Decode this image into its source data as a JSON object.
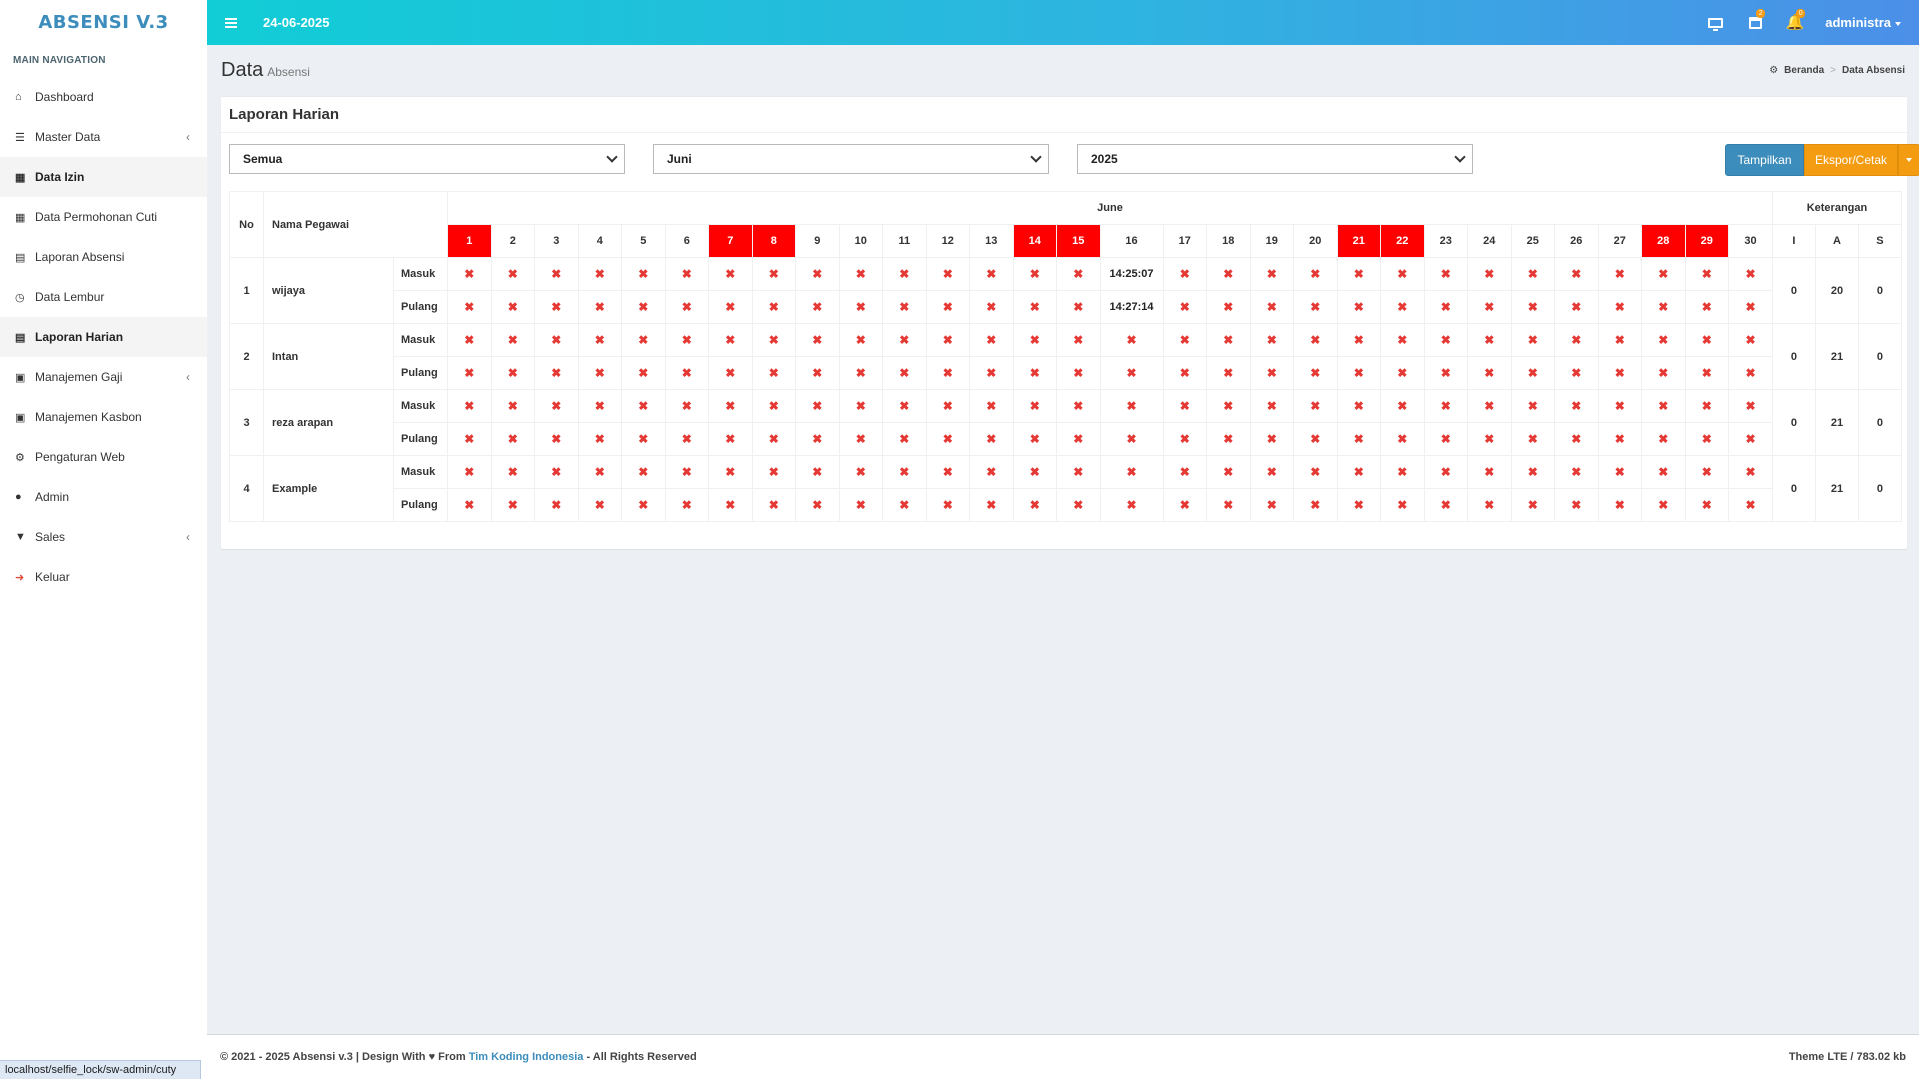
{
  "app": {
    "logo": "ABSENSI V.3",
    "date": "24-06-2025",
    "user": "administra",
    "badges": {
      "calendar": "2",
      "bell": "0"
    }
  },
  "sidebar": {
    "heading": "MAIN NAVIGATION",
    "items": [
      {
        "label": "Dashboard",
        "icon": "home-icon",
        "glyph": "⌂"
      },
      {
        "label": "Master Data",
        "icon": "database-icon",
        "glyph": "☰",
        "has_children": true
      },
      {
        "label": "Data Izin",
        "icon": "calendar-icon",
        "glyph": "▦",
        "active": true
      },
      {
        "label": "Data Permohonan Cuti",
        "icon": "calendar-icon",
        "glyph": "▦"
      },
      {
        "label": "Laporan Absensi",
        "icon": "table-icon",
        "glyph": "▤"
      },
      {
        "label": "Data Lembur",
        "icon": "clock-icon",
        "glyph": "◷"
      },
      {
        "label": "Laporan Harian",
        "icon": "table-icon",
        "glyph": "▤",
        "active": true
      },
      {
        "label": "Manajemen Gaji",
        "icon": "money-icon",
        "glyph": "▣",
        "has_children": true
      },
      {
        "label": "Manajemen Kasbon",
        "icon": "money-icon",
        "glyph": "▣"
      },
      {
        "label": "Pengaturan Web",
        "icon": "cogs-icon",
        "glyph": "⚙"
      },
      {
        "label": "Admin",
        "icon": "user-icon",
        "glyph": "●"
      },
      {
        "label": "Sales",
        "icon": "cart-icon",
        "glyph": "▼",
        "has_children": true
      },
      {
        "label": "Keluar",
        "icon": "sign-out-icon",
        "glyph": "➜",
        "red": true
      }
    ]
  },
  "header": {
    "title": "Data",
    "subtitle": "Absensi",
    "breadcrumb": {
      "home": "Beranda",
      "separator": ">",
      "current": "Data Absensi"
    }
  },
  "box": {
    "title": "Laporan Harian",
    "filters": {
      "pegawai": "Semua",
      "bulan": "Juni",
      "tahun": "2025"
    },
    "buttons": {
      "show": "Tampilkan",
      "export": "Ekspor/Cetak"
    }
  },
  "table": {
    "headers": {
      "no": "No",
      "name": "Nama Pegawai",
      "month": "June",
      "ket": "Keterangan",
      "i": "I",
      "a": "A",
      "s": "S"
    },
    "days": [
      1,
      2,
      3,
      4,
      5,
      6,
      7,
      8,
      9,
      10,
      11,
      12,
      13,
      14,
      15,
      16,
      17,
      18,
      19,
      20,
      21,
      22,
      23,
      24,
      25,
      26,
      27,
      28,
      29,
      30
    ],
    "holidays": [
      1,
      7,
      8,
      14,
      15,
      21,
      22,
      28,
      29
    ],
    "row_labels": {
      "in": "Masuk",
      "out": "Pulang"
    },
    "absent_mark": "✖",
    "employees": [
      {
        "no": "1",
        "name": "wijaya",
        "in_times": {
          "16": "14:25:07"
        },
        "out_times": {
          "16": "14:27:14"
        },
        "i": "0",
        "a": "20",
        "s": "0"
      },
      {
        "no": "2",
        "name": "Intan",
        "in_times": {},
        "out_times": {},
        "i": "0",
        "a": "21",
        "s": "0"
      },
      {
        "no": "3",
        "name": "reza arapan",
        "in_times": {},
        "out_times": {},
        "i": "0",
        "a": "21",
        "s": "0"
      },
      {
        "no": "4",
        "name": "Example",
        "in_times": {},
        "out_times": {},
        "i": "0",
        "a": "21",
        "s": "0"
      }
    ]
  },
  "footer": {
    "left_prefix": "© 2021 - 2025 Absensi v.3 | Design With ",
    "heart": "♥",
    "from": " From ",
    "link": "Tim Koding Indonesia",
    "suffix": " - All Rights Reserved",
    "right": "Theme LTE / 783.02 kb"
  },
  "status_url": "localhost/selfie_lock/sw-admin/cuty"
}
